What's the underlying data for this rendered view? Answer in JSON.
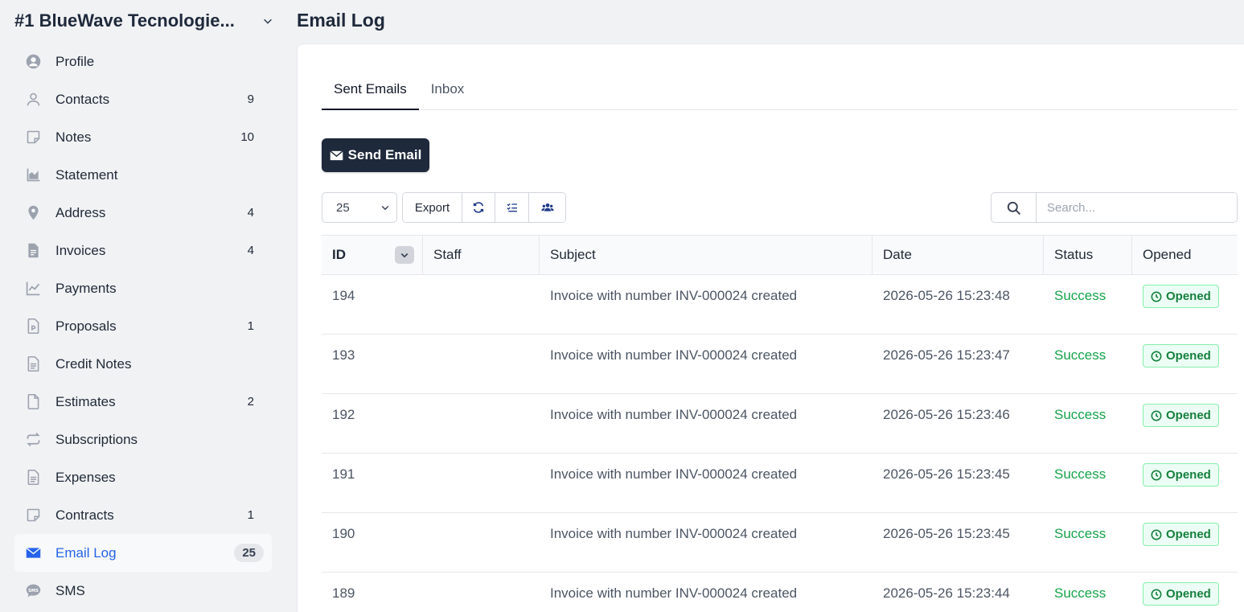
{
  "client": {
    "name": "#1 BlueWave Tecnologie..."
  },
  "page": {
    "title": "Email Log"
  },
  "sidebar": {
    "items": [
      {
        "label": "Profile",
        "count": "",
        "icon": "user-circle-icon"
      },
      {
        "label": "Contacts",
        "count": "9",
        "icon": "user-icon"
      },
      {
        "label": "Notes",
        "count": "10",
        "icon": "sticky-note-icon"
      },
      {
        "label": "Statement",
        "count": "",
        "icon": "area-chart-icon"
      },
      {
        "label": "Address",
        "count": "4",
        "icon": "map-pin-icon"
      },
      {
        "label": "Invoices",
        "count": "4",
        "icon": "file-text-icon"
      },
      {
        "label": "Payments",
        "count": "",
        "icon": "line-chart-icon"
      },
      {
        "label": "Proposals",
        "count": "1",
        "icon": "file-p-icon"
      },
      {
        "label": "Credit Notes",
        "count": "",
        "icon": "file-lines-icon"
      },
      {
        "label": "Estimates",
        "count": "2",
        "icon": "file-icon"
      },
      {
        "label": "Subscriptions",
        "count": "",
        "icon": "repeat-icon"
      },
      {
        "label": "Expenses",
        "count": "",
        "icon": "file-lines-icon"
      },
      {
        "label": "Contracts",
        "count": "1",
        "icon": "sticky-note-icon"
      },
      {
        "label": "Email Log",
        "count": "25",
        "icon": "envelope-icon",
        "active": true
      },
      {
        "label": "SMS",
        "count": "",
        "icon": "sms-icon"
      }
    ]
  },
  "tabs": [
    {
      "label": "Sent Emails",
      "active": true
    },
    {
      "label": "Inbox",
      "active": false
    }
  ],
  "actions": {
    "send_email": "Send Email"
  },
  "toolbar": {
    "per_page": "25",
    "export": "Export"
  },
  "search": {
    "placeholder": "Search..."
  },
  "table": {
    "columns": [
      "ID",
      "Staff",
      "Subject",
      "Date",
      "Status",
      "Opened"
    ],
    "rows": [
      {
        "id": "194",
        "staff": "",
        "subject": "Invoice with number INV-000024 created",
        "date": "2026-05-26 15:23:48",
        "status": "Success",
        "opened": "Opened"
      },
      {
        "id": "193",
        "staff": "",
        "subject": "Invoice with number INV-000024 created",
        "date": "2026-05-26 15:23:47",
        "status": "Success",
        "opened": "Opened"
      },
      {
        "id": "192",
        "staff": "",
        "subject": "Invoice with number INV-000024 created",
        "date": "2026-05-26 15:23:46",
        "status": "Success",
        "opened": "Opened"
      },
      {
        "id": "191",
        "staff": "",
        "subject": "Invoice with number INV-000024 created",
        "date": "2026-05-26 15:23:45",
        "status": "Success",
        "opened": "Opened"
      },
      {
        "id": "190",
        "staff": "",
        "subject": "Invoice with number INV-000024 created",
        "date": "2026-05-26 15:23:45",
        "status": "Success",
        "opened": "Opened"
      },
      {
        "id": "189",
        "staff": "",
        "subject": "Invoice with number INV-000024 created",
        "date": "2026-05-26 15:23:44",
        "status": "Success",
        "opened": "Opened"
      }
    ]
  },
  "colors": {
    "accent": "#2563eb",
    "dark_button": "#1e293b",
    "success": "#16a34a"
  }
}
